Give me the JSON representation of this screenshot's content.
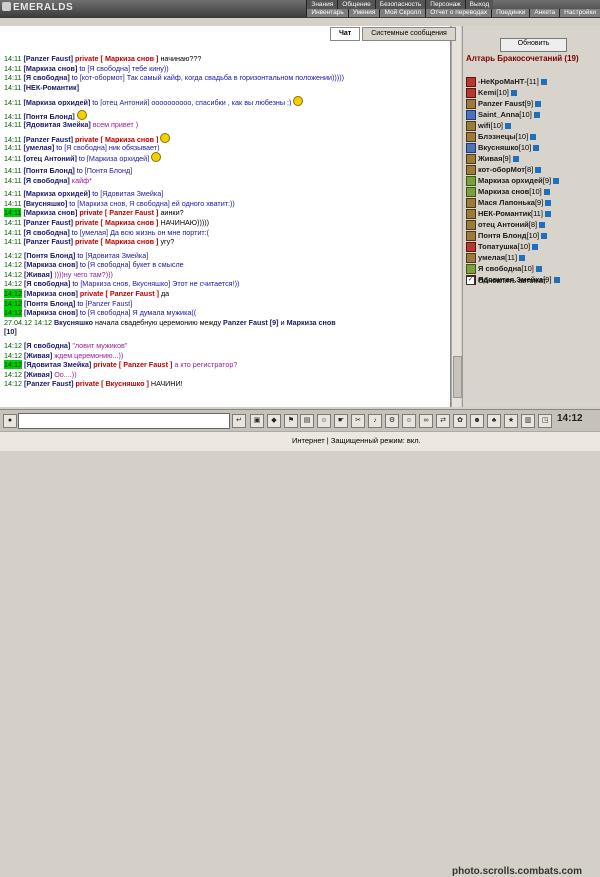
{
  "app": {
    "logo": "EMERALDS"
  },
  "menu": {
    "top": [
      "Знания",
      "Общение",
      "Безопасность",
      "Персонаж",
      "Выход"
    ],
    "bottom": [
      "Инвентарь",
      "Умения",
      "Мой Скролл",
      "Отчет о переводах",
      "Поединки",
      "Анкета",
      "Настройки"
    ]
  },
  "tabs": [
    {
      "label": "Чат",
      "active": true
    },
    {
      "label": "Системные сообщения",
      "active": false
    }
  ],
  "chat": {
    "messages": [
      {
        "time": "14:11",
        "hl": false,
        "parts": [
          [
            "nick",
            "[Panzer Faust]"
          ],
          [
            "priv",
            "private [ Маркиза снов ]"
          ],
          [
            "t-black",
            "начинаю???"
          ]
        ]
      },
      {
        "time": "14:11",
        "hl": false,
        "parts": [
          [
            "nick",
            "[Маркиза снов]"
          ],
          [
            "kw",
            "to"
          ],
          [
            "recip",
            "[Я свободна]"
          ],
          [
            "t-blue",
            "тебе кину))"
          ]
        ]
      },
      {
        "time": "14:11",
        "hl": false,
        "parts": [
          [
            "nick",
            "[Я свободна]"
          ],
          [
            "kw",
            "to"
          ],
          [
            "recip",
            "[кот-обормот]"
          ],
          [
            "t-blue",
            "Так самый кайф, когда свадьба в горизонтальном положении)))))"
          ]
        ]
      },
      {
        "time": "14:11",
        "hl": false,
        "parts": [
          [
            "nick",
            "[НЕК-Романтик]"
          ]
        ]
      },
      {
        "time": "14:11",
        "hl": false,
        "gap": true,
        "parts": [
          [
            "nick",
            "[Маркиза орхидей]"
          ],
          [
            "kw",
            "to"
          ],
          [
            "recip",
            "[отец Антоний]"
          ],
          [
            "t-blue",
            "оооооооооо, спасибки , как вы любезны :)"
          ]
        ],
        "smiley": true
      },
      {
        "time": "14:11",
        "hl": false,
        "gap": true,
        "parts": [
          [
            "nick",
            "[Понтя Блонд]"
          ]
        ],
        "smiley": true
      },
      {
        "time": "14:11",
        "hl": false,
        "parts": [
          [
            "nick",
            "[Ядовитая Змейка]"
          ],
          [
            "t-purple",
            "всем привет )"
          ]
        ]
      },
      {
        "time": "14:11",
        "hl": false,
        "gap": true,
        "parts": [
          [
            "nick",
            "[Panzer Faust]"
          ],
          [
            "priv",
            "private [ Маркиза снов ]"
          ]
        ],
        "smiley": true
      },
      {
        "time": "14:11",
        "hl": false,
        "parts": [
          [
            "nick",
            "[умелая]"
          ],
          [
            "kw",
            "to"
          ],
          [
            "recip",
            "[Я свободна]"
          ],
          [
            "t-blue",
            "ник обязывает)"
          ]
        ]
      },
      {
        "time": "14:11",
        "hl": false,
        "parts": [
          [
            "nick",
            "[отец Антоний]"
          ],
          [
            "kw",
            "to"
          ],
          [
            "recip",
            "[Маркиза орхидей]"
          ]
        ],
        "smiley": true
      },
      {
        "time": "14:11",
        "hl": false,
        "gap": true,
        "parts": [
          [
            "nick",
            "[Понтя Блонд]"
          ],
          [
            "kw",
            "to"
          ],
          [
            "recip",
            "[Понтя Блонд]"
          ]
        ]
      },
      {
        "time": "14:11",
        "hl": false,
        "parts": [
          [
            "nick",
            "[Я свободна]"
          ],
          [
            "t-purple",
            "кайф*"
          ]
        ]
      },
      {
        "time": "14:11",
        "hl": false,
        "gap": true,
        "parts": [
          [
            "nick",
            "[Маркиза орхидей]"
          ],
          [
            "kw",
            "to"
          ],
          [
            "recip",
            "[Ядовитая Змейка]"
          ]
        ]
      },
      {
        "time": "14:11",
        "hl": false,
        "parts": [
          [
            "nick",
            "[Вкусняшко]"
          ],
          [
            "kw",
            "to"
          ],
          [
            "recip",
            "[Маркиза снов, Я свободна]"
          ],
          [
            "t-blue",
            "ей одного хватит:))"
          ]
        ]
      },
      {
        "time": "14:11",
        "hl": true,
        "parts": [
          [
            "nick",
            "[Маркиза снов]"
          ],
          [
            "priv",
            "private [ Panzer Faust ]"
          ],
          [
            "t-black",
            "аинки?"
          ]
        ]
      },
      {
        "time": "14:11",
        "hl": false,
        "parts": [
          [
            "nick",
            "[Panzer Faust]"
          ],
          [
            "priv",
            "private [ Маркиза снов ]"
          ],
          [
            "t-black",
            "НАЧИНАЮ)))))"
          ]
        ]
      },
      {
        "time": "14:11",
        "hl": false,
        "parts": [
          [
            "nick",
            "[Я свободна]"
          ],
          [
            "kw",
            "to"
          ],
          [
            "recip",
            "[умелая]"
          ],
          [
            "t-blue",
            "Да всю жизнь он мне портит:("
          ]
        ]
      },
      {
        "time": "14:11",
        "hl": false,
        "parts": [
          [
            "nick",
            "[Panzer Faust]"
          ],
          [
            "priv",
            "private [ Маркиза снов ]"
          ],
          [
            "t-black",
            "угу?"
          ]
        ]
      },
      {
        "time": "14:12",
        "hl": false,
        "gap": true,
        "parts": [
          [
            "nick",
            "[Понтя Блонд]"
          ],
          [
            "kw",
            "to"
          ],
          [
            "recip",
            "[Ядовитая Змейка]"
          ]
        ]
      },
      {
        "time": "14:12",
        "hl": false,
        "parts": [
          [
            "nick",
            "[Маркиза снов]"
          ],
          [
            "kw",
            "to"
          ],
          [
            "recip",
            "[Я свободна]"
          ],
          [
            "t-blue",
            "букет в смысле"
          ]
        ]
      },
      {
        "time": "14:12",
        "hl": false,
        "parts": [
          [
            "nick",
            "[Живая]"
          ],
          [
            "t-purple",
            "))))ну чего там?)))"
          ]
        ]
      },
      {
        "time": "14:12",
        "hl": false,
        "parts": [
          [
            "nick",
            "[Я свободна]"
          ],
          [
            "kw",
            "to"
          ],
          [
            "recip",
            "[Маркиза снов, Вкусняшко]"
          ],
          [
            "t-blue",
            "Этот не считается!))"
          ]
        ]
      },
      {
        "time": "14:12",
        "hl": true,
        "parts": [
          [
            "nick",
            "[Маркиза снов]"
          ],
          [
            "priv",
            "private [ Panzer Faust ]"
          ],
          [
            "t-black",
            "да"
          ]
        ]
      },
      {
        "time": "14:12",
        "hl": true,
        "parts": [
          [
            "nick",
            "[Понтя Блонд]"
          ],
          [
            "kw",
            "to"
          ],
          [
            "recip",
            "[Panzer Faust]"
          ]
        ]
      },
      {
        "time": "14:12",
        "hl": true,
        "parts": [
          [
            "nick",
            "[Маркиза снов]"
          ],
          [
            "kw",
            "to"
          ],
          [
            "recip",
            "[Я свободна]"
          ],
          [
            "t-blue",
            "Я думала мужика(("
          ]
        ]
      },
      {
        "time": "27.04.12 14:12",
        "hl": false,
        "parts": [
          [
            "nick",
            "Вкусняшко"
          ],
          [
            "t-black",
            "начала свадебную церемонию между"
          ],
          [
            "nick",
            "Panzer Faust [9]"
          ],
          [
            "t-black",
            "и"
          ],
          [
            "nick",
            "Маркиза снов"
          ]
        ]
      },
      {
        "time": "",
        "hl": false,
        "parts": [
          [
            "nick",
            "[10]"
          ]
        ]
      },
      {
        "time": "14:12",
        "hl": false,
        "gap": true,
        "parts": [
          [
            "nick",
            "[Я свободна]"
          ],
          [
            "t-purple",
            "\"ловит мужиков\""
          ]
        ]
      },
      {
        "time": "14:12",
        "hl": false,
        "parts": [
          [
            "nick",
            "[Живая]"
          ],
          [
            "t-purple",
            "ждем церемонию...))"
          ]
        ]
      },
      {
        "time": "14:12",
        "hl": true,
        "parts": [
          [
            "nick",
            "[Ядовитая Змейка]"
          ],
          [
            "priv",
            "private [ Panzer Faust ]"
          ],
          [
            "t-purple",
            "а кто регистратор?"
          ]
        ]
      },
      {
        "time": "14:12",
        "hl": false,
        "parts": [
          [
            "nick",
            "[Живая]"
          ],
          [
            "t-purple",
            "Оо....))"
          ]
        ]
      },
      {
        "time": "14:12",
        "hl": false,
        "parts": [
          [
            "nick",
            "[Panzer Faust]"
          ],
          [
            "priv",
            "private [ Вкусняшко ]"
          ],
          [
            "t-black",
            "НАЧИНИ!"
          ]
        ]
      }
    ]
  },
  "sidebar": {
    "refresh_label": "Обновить",
    "room_title": "Алтарь Бракосочетаний (19)",
    "users": [
      {
        "name": "-НеКроМаНТ-",
        "level": "[11]",
        "icon": "r"
      },
      {
        "name": "Kemi",
        "level": "[10]",
        "icon": "r"
      },
      {
        "name": "Panzer Faust",
        "level": "[9]",
        "icon": ""
      },
      {
        "name": "Saint_Anna",
        "level": "[10]",
        "icon": "b"
      },
      {
        "name": "wifi",
        "level": "[10]",
        "icon": ""
      },
      {
        "name": "Блэзнецы",
        "level": "[10]",
        "icon": ""
      },
      {
        "name": "Вкусняшко",
        "level": "[10]",
        "icon": "b"
      },
      {
        "name": "Живая",
        "level": "[9]",
        "icon": ""
      },
      {
        "name": "кот-оборМот",
        "level": "[8]",
        "icon": ""
      },
      {
        "name": "Маркиза орхидей",
        "level": "[9]",
        "icon": "g"
      },
      {
        "name": "Маркиза снов",
        "level": "[10]",
        "icon": "g"
      },
      {
        "name": "Мася Лапонька",
        "level": "[9]",
        "icon": ""
      },
      {
        "name": "НЕК-Романтик",
        "level": "[11]",
        "icon": ""
      },
      {
        "name": "отец Антоний",
        "level": "[8]",
        "icon": ""
      },
      {
        "name": "Понтя Блонд",
        "level": "[10]",
        "icon": ""
      },
      {
        "name": "Топатушка",
        "level": "[10]",
        "icon": "r"
      },
      {
        "name": "умелая",
        "level": "[11]",
        "icon": ""
      },
      {
        "name": "Я свободна",
        "level": "[10]",
        "icon": "g"
      },
      {
        "name": "Ядовитая Змейка",
        "level": "[9]",
        "icon": "r"
      }
    ],
    "auto_refresh_label": "Обновлять автомат.",
    "auto_refresh_checked": true
  },
  "toolbar": {
    "clock": "14:12"
  },
  "status": {
    "text": "Интернет | Защищенный режим: вкл."
  },
  "watermark": "photo.scrolls.combats.com"
}
